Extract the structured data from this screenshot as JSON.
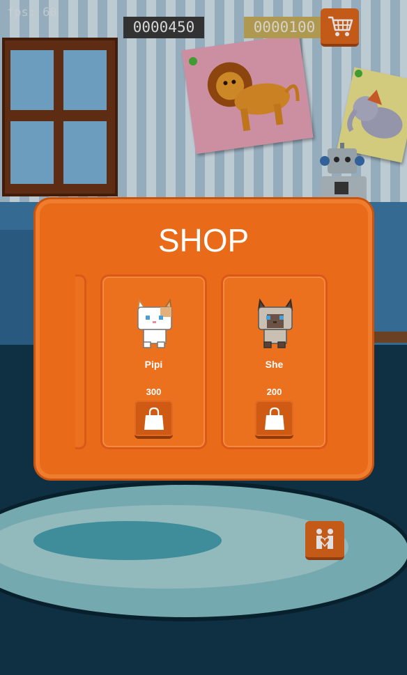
{
  "hud": {
    "fps_label": "fps: 60",
    "score": "0000450",
    "coins": "0000100"
  },
  "icons": {
    "cart": "cart-icon",
    "shopping_bag": "shopping-bag-icon",
    "couple": "couple-heart-icon"
  },
  "shop": {
    "title": "SHOP",
    "items": [
      {
        "name": "Pipi",
        "price": "300"
      },
      {
        "name": "She",
        "price": "200"
      }
    ]
  },
  "colors": {
    "panel_orange": "#e96b1a",
    "button_orange": "#e0671b",
    "coin_gold": "#c8ad5c",
    "score_bg": "#3a3a3a"
  }
}
